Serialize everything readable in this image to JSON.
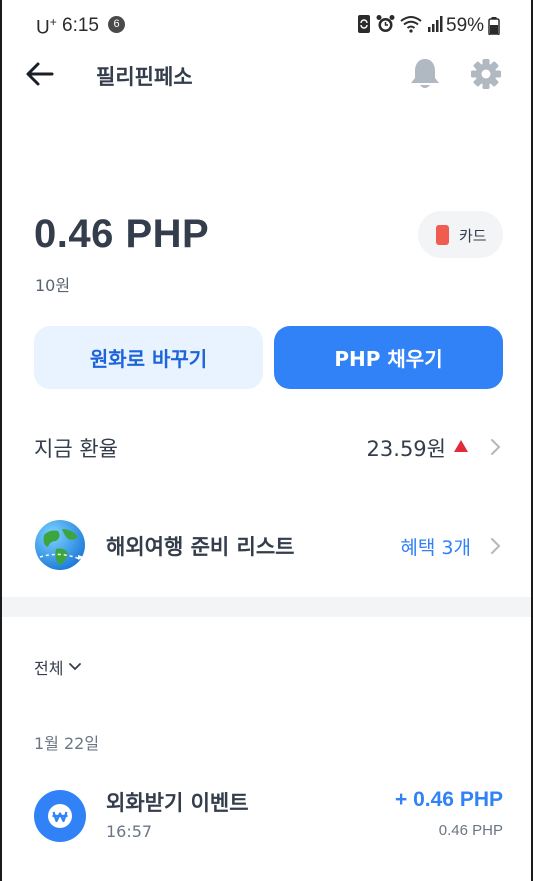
{
  "status_bar": {
    "carrier": "U",
    "carrier_sup": "+",
    "time": "6:15",
    "notification_count": "6",
    "battery": "59%"
  },
  "header": {
    "title": "필리핀페소",
    "icons": [
      "back-arrow-icon",
      "bell-icon",
      "gear-icon"
    ]
  },
  "account": {
    "balance": "0.46 PHP",
    "balance_krw": "10원",
    "card_label": "카드"
  },
  "actions": {
    "exchange_label": "원화로 바꾸기",
    "charge_label": "PHP 채우기"
  },
  "rate": {
    "label": "지금 환율",
    "value": "23.59원",
    "trend": "up"
  },
  "travel": {
    "label": "해외여행 준비 리스트",
    "benefit": "혜택 3개"
  },
  "filter": {
    "label": "전체"
  },
  "transactions": {
    "date": "1월 22일",
    "items": [
      {
        "title": "외화받기 이벤트",
        "time": "16:57",
        "amount": "+ 0.46 PHP",
        "balance_after": "0.46 PHP"
      }
    ]
  },
  "colors": {
    "accent": "#3182f6",
    "accent_light": "#e8f3ff",
    "text": "#333d4b",
    "subtext": "#6b7684",
    "rate_up": "#e42939",
    "card_icon": "#f05c4f"
  }
}
